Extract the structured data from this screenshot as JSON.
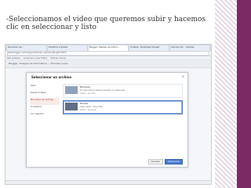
{
  "caption": "-Seleccionamos el video que queremos subir y hacemos clic en seleccionar y listo",
  "browser": {
    "tabs": [
      "Educación de...",
      "Planificar a Upload",
      "Blogger: Trabajos de Inform...",
      "YouTube - Broadcast Yourself",
      "Introducción - YouTube"
    ],
    "address": "www.blogger.com/img/upload/video-upload.g?blogID=5972…",
    "bookmarks": [
      "Más visitados",
      "Comenzar a usar Firefox",
      "Últimas noticias"
    ]
  },
  "blogger": {
    "bar_text": "Blogger: Trabajos de Informática — Entrada nueva"
  },
  "dialog": {
    "title": "Seleccionar un archivo",
    "close": "✕",
    "sidebar": [
      "Subir",
      "Desde YouTube",
      "Mis vídeos de YouTube",
      "Tu teléfono",
      "Con webcam"
    ],
    "videos": [
      {
        "title": "Educación",
        "desc": "Un video sobre el sistema educativo en nuestro país",
        "date": "Subido · Abr 2012"
      },
      {
        "title": "Escuela",
        "desc": "Video casero · mayo 2012",
        "date": "Subido · May 2012"
      }
    ],
    "buttons": {
      "select": "Seleccionar",
      "cancel": "Cancelar"
    }
  }
}
